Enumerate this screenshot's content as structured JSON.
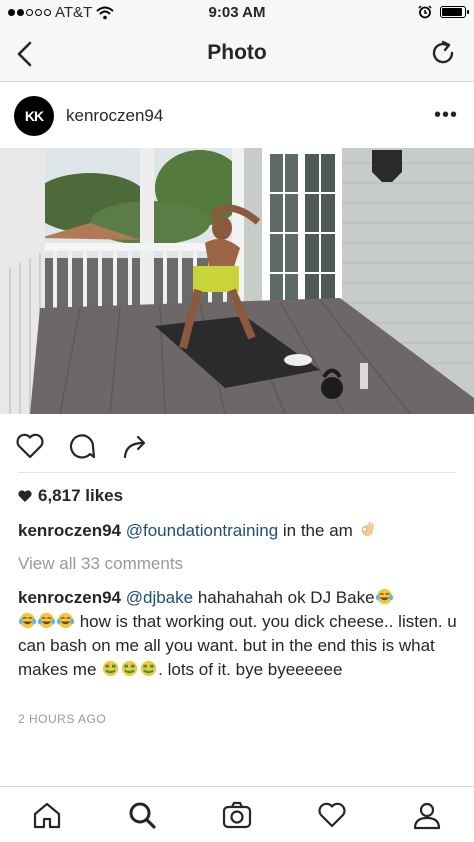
{
  "status_bar": {
    "carrier": "AT&T",
    "time": "9:03 AM",
    "signal_bars": 2,
    "signal_total": 5,
    "battery_level": 0.95
  },
  "nav": {
    "title": "Photo",
    "back_icon": "chevron-left-icon",
    "refresh_icon": "refresh-icon"
  },
  "post": {
    "username": "kenroczen94",
    "avatar_text": "KK",
    "more_label": "•••",
    "likes_count": "6,817 likes",
    "caption": {
      "username": "kenroczen94",
      "mention": "@foundationtraining",
      "text": " in the am"
    },
    "view_all_comments": "View all 33 comments",
    "comment": {
      "username": "kenroczen94",
      "mention": "@djbake",
      "text_1": " hahahahah ok DJ Bake",
      "text_2": " how is that working out. you dick cheese.. listen. u can bash on me all you want. but in the end this is what makes me ",
      "text_3": ". lots of it. bye byeeeeee"
    },
    "timestamp": "2 HOURS AGO"
  },
  "colors": {
    "accent_link": "#1d4f7a",
    "muted": "#999999",
    "bar_bg": "#f7f7f7"
  },
  "tabs": [
    "home-icon",
    "search-icon",
    "camera-icon",
    "heart-icon",
    "profile-icon"
  ]
}
